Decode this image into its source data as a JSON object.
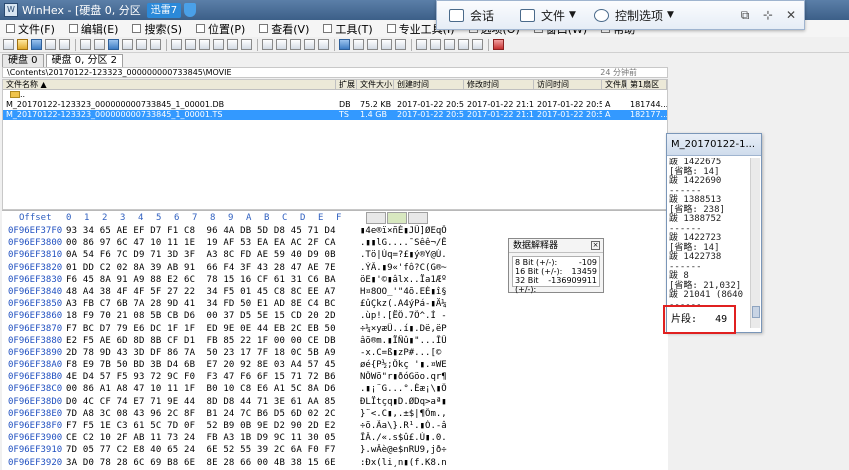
{
  "window": {
    "app_title": "WinHex - [硬盘 0, 分区",
    "xunlei_badge": "迅雷7"
  },
  "menu": [
    "文件(F)",
    "编辑(E)",
    "搜索(S)",
    "位置(P)",
    "查看(V)",
    "工具(T)",
    "专业工具(I)",
    "选项(O)",
    "窗口(W)",
    "帮助"
  ],
  "floatbar": {
    "chat": "会话",
    "file": "文件",
    "control": "控制选项"
  },
  "tabs": [
    "硬盘 0",
    "硬盘 0, 分区 2"
  ],
  "path": {
    "text": "\\Contents\\20170122-123323_000000000733845\\MOVIE",
    "minutes": "24 分钟前"
  },
  "file_columns": [
    "文件名称 ▲",
    "扩展",
    "文件大小",
    "创建时间",
    "修改时间",
    "访问时间",
    "文件属",
    "第1扇区"
  ],
  "files": [
    {
      "name": "..",
      "ext": "",
      "size": "",
      "created": "",
      "modified": "",
      "accessed": "",
      "attr": "",
      "sector": ""
    },
    {
      "name": "M_20170122-123323_000000000733845_1_00001.DB",
      "ext": "DB",
      "size": "75.2 KB",
      "created": "2017-01-22  20:5...",
      "modified": "2017-01-22  21:1...",
      "accessed": "2017-01-22  20:5...",
      "attr": "A",
      "sector": "181744..."
    },
    {
      "name": "M_20170122-123323_000000000733845_1_00001.TS",
      "ext": "TS",
      "size": "1.4 GB",
      "created": "2017-01-22  20:5...",
      "modified": "2017-01-22  21:1...",
      "accessed": "2017-01-22  20:5...",
      "attr": "A",
      "sector": "182177..."
    }
  ],
  "hex": {
    "offset_label": "Offset",
    "columns": [
      "0",
      "1",
      "2",
      "3",
      "4",
      "5",
      "6",
      "7",
      "8",
      "9",
      "A",
      "B",
      "C",
      "D",
      "E",
      "F"
    ],
    "rows": [
      {
        "off": "0F96EF37F0",
        "bytes": "93 34 65 AE EF D7 F1 C8  96 4A DB 5D D8 45 71 D4",
        "asc": "▮4e®ï×ñÈ▮JÛ]ØEqÔ"
      },
      {
        "off": "0F96EF3800",
        "bytes": "00 86 97 6C 47 10 11 1E  19 AF 53 EA EA AC 2F CA",
        "asc": ".▮▮lG....¯Sêê¬/Ê"
      },
      {
        "off": "0F96EF3810",
        "bytes": "0A 54 F6 7C D9 71 3D 3F  A3 8C FD AE 59 40 D9 0B",
        "asc": ".Tö|Ùq=?£▮ý®Y@Ù."
      },
      {
        "off": "0F96EF3820",
        "bytes": "01 DD C2 02 8A 39 AB 91  66 F4 3F 43 28 47 AE 7E",
        "asc": ".ÝÂ.▮9«'fô?C(G®~"
      },
      {
        "off": "0F96EF3830",
        "bytes": "F6 45 8A 91 A9 88 E2 6C  78 15 16 CF 61 31 C6 BA",
        "asc": "öE▮'©▮âlx..Ïa1Æº"
      },
      {
        "off": "0F96EF3840",
        "bytes": "48 A4 38 4F 4F 5F 27 22  34 F5 01 45 C8 8C EE A7",
        "asc": "H¤8OO_'\"4õ.EÈ▮î§"
      },
      {
        "off": "0F96EF3850",
        "bytes": "A3 FB C7 6B 7A 28 9D 41  34 FD 50 E1 AD 8E C4 BC",
        "asc": "£ûÇkz(.A4ýPá-▮Ä¼"
      },
      {
        "off": "0F96EF3860",
        "bytes": "18 F9 70 21 08 5B CB D6  00 37 D5 5E 15 CD 20 2D",
        "asc": ".ùp!.[ËÖ.7Õ^.Í -"
      },
      {
        "off": "0F96EF3870",
        "bytes": "F7 BC D7 79 E6 DC 1F 1F  ED 9E 0E 44 EB 2C EB 50",
        "asc": "÷¼×yæÜ..í▮.Dë,ëP"
      },
      {
        "off": "0F96EF3880",
        "bytes": "E2 F5 AE 6D 8D 8B CF D1  FB 85 22 1F 00 00 CE DB",
        "asc": "âõ®m.▮ÏÑû▮\"...ÎÛ"
      },
      {
        "off": "0F96EF3890",
        "bytes": "2D 78 9D 43 3D DF 86 7A  50 23 17 7F 18 0C 5B A9",
        "asc": "-x.C=ß▮zP#...[©"
      },
      {
        "off": "0F96EF38A0",
        "bytes": "F8 E9 7B 50 BD 3B D4 6B  E7 20 92 8E 03 A4 57 45",
        "asc": "øé{P½;Ôkç '▮.¤WE"
      },
      {
        "off": "0F96EF38B0",
        "bytes": "4E D4 57 F5 93 72 9C F0  F3 47 F6 6F 15 71 72 B6",
        "asc": "NÔWõ\"r▮ðóGöo.qr¶"
      },
      {
        "off": "0F96EF38C0",
        "bytes": "00 86 A1 A8 47 10 11 1F  B0 10 C8 E6 A1 5C 8A D6",
        "asc": ".▮¡¨G...°.Èæ¡\\▮Ö"
      },
      {
        "off": "0F96EF38D0",
        "bytes": "D0 4C CF 74 E7 71 9E 44  8D D8 44 71 3E 61 AA 85",
        "asc": "ÐLÏtçq▮D.ØDq>aª▮"
      },
      {
        "off": "0F96EF38E0",
        "bytes": "7D A8 3C 08 43 96 2C 8F  B1 24 7C B6 D5 6D 02 2C",
        "asc": "}¨<.C▮,.±$|¶Õm.,"
      },
      {
        "off": "0F96EF38F0",
        "bytes": "F7 F5 1E C3 61 5C 7D 0F  52 B9 0B 9E D2 90 2D E2",
        "asc": "÷õ.Ãa\\}.R¹.▮Ò.-â"
      },
      {
        "off": "0F96EF3900",
        "bytes": "CE C2 10 2F AB 11 73 24  FB A3 1B D9 9C 11 30 05",
        "asc": "ÎÂ./«.s$û£.Ù▮.0."
      },
      {
        "off": "0F96EF3910",
        "bytes": "7D 05 77 C2 E8 40 65 24  6E 52 55 39 2C 6A F0 F7",
        "asc": "}.wÂè@e$nRU9,jð÷"
      },
      {
        "off": "0F96EF3920",
        "bytes": "3A D0 78 28 6C 69 B8 6E  8E 28 66 00 4B 38 15 6E",
        "asc": ":Ðx(li¸n▮(f.K8.n"
      }
    ]
  },
  "decoder": {
    "title": "数据解释器",
    "rows": [
      {
        "label": "8 Bit (+/-):",
        "value": "-109"
      },
      {
        "label": "16 Bit (+/-):",
        "value": "13459"
      },
      {
        "label": "32 Bit (+/-):",
        "value": "-136909911"
      }
    ]
  },
  "clipboard": {
    "title": "M_20170122-1...",
    "content": "跋 1422675\n[省略: 14]\n跋 1422690\n------\n跋 1388513\n[省略: 238]\n跋 1388752\n------\n跋 1422723\n[省略: 14]\n跋 1422738\n------\n跋 8\n[省略: 21,032]\n跋 21041 (8640\n------",
    "count_label": "片段:",
    "count_value": "49"
  }
}
